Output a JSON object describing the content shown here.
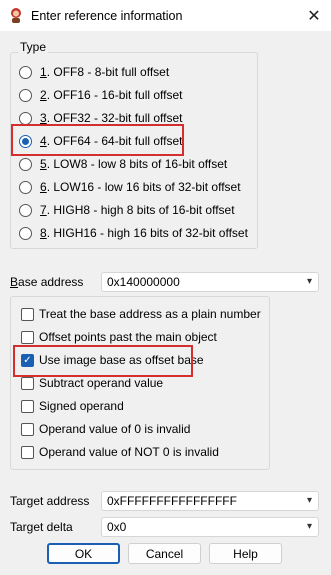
{
  "window": {
    "title": "Enter reference information",
    "close_icon": "close-icon",
    "app_icon": "ida-app-icon"
  },
  "type_group": {
    "legend": "Type",
    "options": [
      {
        "key": "1",
        "rest": ". OFF8 - 8-bit full offset",
        "checked": false
      },
      {
        "key": "2",
        "rest": ". OFF16 - 16-bit full offset",
        "checked": false
      },
      {
        "key": "3",
        "rest": ". OFF32 - 32-bit full offset",
        "checked": false
      },
      {
        "key": "4",
        "rest": ". OFF64 - 64-bit full offset",
        "checked": true
      },
      {
        "key": "5",
        "rest": ". LOW8 - low 8 bits of 16-bit offset",
        "checked": false
      },
      {
        "key": "6",
        "rest": ". LOW16 - low 16 bits of 32-bit offset",
        "checked": false
      },
      {
        "key": "7",
        "rest": ". HIGH8 - high 8 bits of 16-bit offset",
        "checked": false
      },
      {
        "key": "8",
        "rest": ". HIGH16 - high 16 bits of 32-bit offset",
        "checked": false
      }
    ]
  },
  "base_address": {
    "label_pre": "B",
    "label_rest": "ase address",
    "value": "0x140000000"
  },
  "options": [
    {
      "label": "Treat the base address as a plain number",
      "checked": false
    },
    {
      "label": "Offset points past the main object",
      "checked": false
    },
    {
      "label": "Use image base as offset base",
      "checked": true
    },
    {
      "label": "Subtract operand value",
      "checked": false
    },
    {
      "label": "Signed operand",
      "checked": false
    },
    {
      "label": "Operand value of 0 is invalid",
      "checked": false
    },
    {
      "label": "Operand value of NOT 0 is invalid",
      "checked": false
    }
  ],
  "target_address": {
    "label": "Target address",
    "value": "0xFFFFFFFFFFFFFFFF"
  },
  "target_delta": {
    "label": "Target delta",
    "value": "0x0"
  },
  "buttons": {
    "ok": "OK",
    "cancel": "Cancel",
    "help": "Help"
  },
  "highlight_color": "#d32f2f",
  "accent_color": "#1a5fb4"
}
